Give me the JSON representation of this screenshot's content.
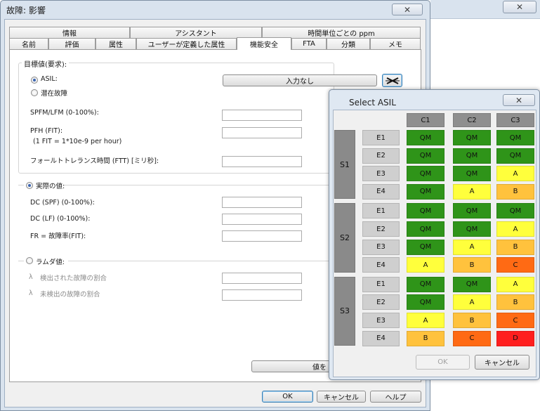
{
  "main_dialog": {
    "title": "故障: 影響",
    "close_glyph": "✕",
    "tabs_row1": [
      "情報",
      "アシスタント",
      "時間単位ごとの ppm"
    ],
    "tabs_row2": [
      "名前",
      "評価",
      "属性",
      "ユーザーが定義した属性",
      "機能安全",
      "FTA",
      "分類",
      "メモ"
    ],
    "active_tab": "機能安全",
    "target_group": {
      "label": "目標値(要求):",
      "asil_label": "ASIL:",
      "asil_selected": true,
      "asil_value_button": "入力なし",
      "latent_label": "潜在故障",
      "spfm_label": "SPFM/LFM (0-100%):",
      "pfh_label": "PFH (FIT):",
      "pfh_note": "(1 FIT = 1*10e-9 per hour)",
      "ftt_label": "フォールトトレランス時間 (FTT) [ミリ秒]:"
    },
    "actual_group": {
      "label": "実際の値:",
      "selected": true,
      "dc_spf_label": "DC (SPF) (0-100%):",
      "dc_lf_label": "DC (LF) (0-100%):",
      "fr_label": "FR = 故障率(FIT):"
    },
    "lambda_group": {
      "label": "ラムダ値:",
      "selected": false,
      "detected_label": "検出された故障の割合",
      "undetected_label": "未検出の故障の割合",
      "lambda_glyph": "λ"
    },
    "apply_value_button": "値を",
    "ok_button": "OK",
    "cancel_button": "キャンセル",
    "help_button": "ヘルプ"
  },
  "asil_popup": {
    "title": "Select ASIL",
    "close_glyph": "✕",
    "columns": [
      "C1",
      "C2",
      "C3"
    ],
    "exposures": [
      "E1",
      "E2",
      "E3",
      "E4"
    ],
    "severities": [
      {
        "name": "S1",
        "rows": [
          [
            "QM",
            "QM",
            "QM"
          ],
          [
            "QM",
            "QM",
            "QM"
          ],
          [
            "QM",
            "QM",
            "A"
          ],
          [
            "QM",
            "A",
            "B"
          ]
        ]
      },
      {
        "name": "S2",
        "rows": [
          [
            "QM",
            "QM",
            "QM"
          ],
          [
            "QM",
            "QM",
            "A"
          ],
          [
            "QM",
            "A",
            "B"
          ],
          [
            "A",
            "B",
            "C"
          ]
        ]
      },
      {
        "name": "S3",
        "rows": [
          [
            "QM",
            "QM",
            "A"
          ],
          [
            "QM",
            "A",
            "B"
          ],
          [
            "A",
            "B",
            "C"
          ],
          [
            "B",
            "C",
            "D"
          ]
        ]
      }
    ],
    "colors": {
      "QM": "#2f9419",
      "A": "#ffff3c",
      "B": "#ffc23d",
      "C": "#ff6a14",
      "D": "#ff1f1f"
    },
    "ok_button": "OK",
    "cancel_button": "キャンセル"
  }
}
